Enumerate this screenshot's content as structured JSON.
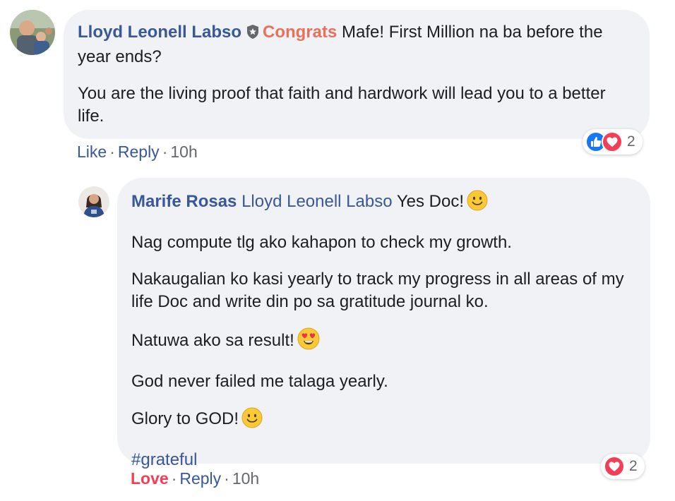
{
  "comment": {
    "author": "Lloyd Leonell Labso",
    "badge_icon": "top-fan-shield-icon",
    "congrats_word": "Congrats",
    "line1_rest": " Mafe! First Million na ba before the year ends?",
    "paragraph2": "You are the living proof that faith and hardwork will lead you to a better life.",
    "actions": {
      "like": "Like",
      "reply": "Reply",
      "time": "10h",
      "sep": "·"
    },
    "reactions": {
      "icons": [
        "like-icon",
        "love-icon"
      ],
      "count": "2"
    }
  },
  "reply": {
    "author": "Marife Rosas",
    "mention": "Lloyd Leonell Labso",
    "first_line_rest": " Yes Doc!",
    "paragraphs": [
      "Nag compute tlg ako kahapon to check my growth.",
      "Nakaugalian ko kasi yearly to track my progress in all areas of my life Doc and write din po sa gratitude journal ko.",
      "Natuwa ako sa result!",
      "God never failed me talaga yearly.",
      "Glory to GOD!"
    ],
    "hashtag": "#grateful",
    "actions": {
      "love": "Love",
      "reply": "Reply",
      "time": "10h",
      "sep": "·"
    },
    "reactions": {
      "icons": [
        "love-icon"
      ],
      "count": "2"
    }
  },
  "colors": {
    "link_blue": "#385898",
    "congrats_orange": "#e9705a",
    "love_red": "#f33e58",
    "like_blue": "#1877f2",
    "bubble_gray": "#f0f2f5",
    "meta_gray": "#65676b"
  }
}
